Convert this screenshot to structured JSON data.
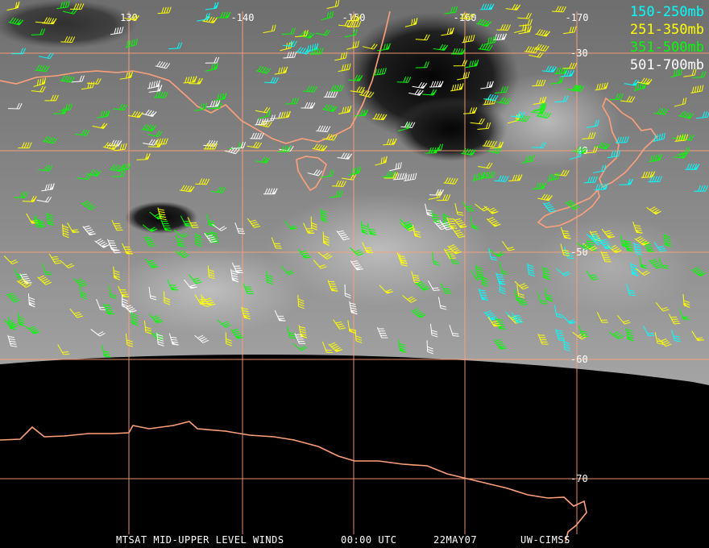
{
  "footer": {
    "product": "MTSAT MID-UPPER LEVEL WINDS",
    "time": "00:00 UTC",
    "date": "22MAY07",
    "source": "UW-CIMSS"
  },
  "legend": [
    {
      "label": "150-250mb",
      "color": "#00ffff"
    },
    {
      "label": "251-350mb",
      "color": "#ffff00"
    },
    {
      "label": "351-500mb",
      "color": "#00ff00"
    },
    {
      "label": "501-700mb",
      "color": "#ffffff"
    }
  ],
  "grid": {
    "color": "#ffa07a",
    "longitude_labels": [
      "130",
      "-140",
      "-150",
      "-160",
      "-170"
    ],
    "latitude_labels": [
      "-30",
      "-40",
      "-50",
      "-60",
      "-70"
    ]
  },
  "colors": {
    "coastline": "#ffa07a",
    "space": "#000000"
  }
}
